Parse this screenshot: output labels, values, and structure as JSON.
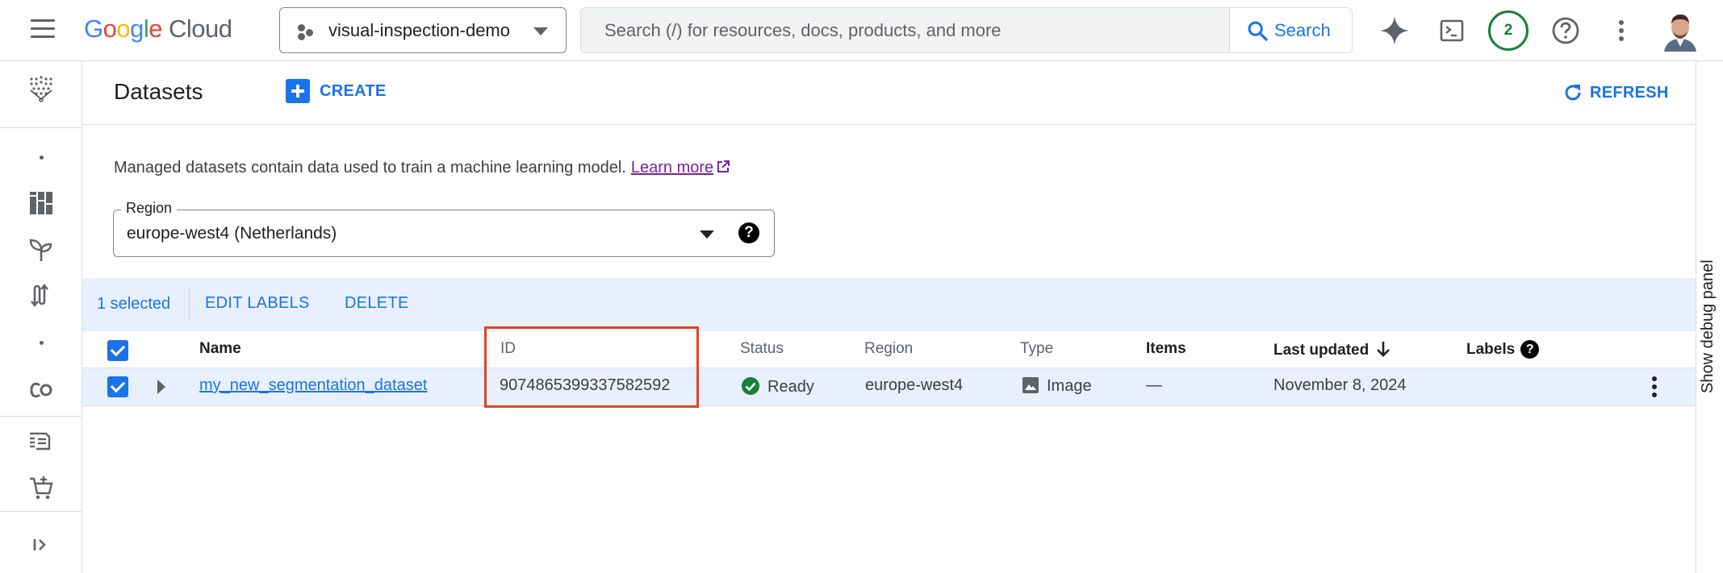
{
  "topbar": {
    "logo_google": [
      "G",
      "o",
      "o",
      "g",
      "l",
      "e"
    ],
    "logo_cloud": "Cloud",
    "project": "visual-inspection-demo",
    "search_placeholder": "Search (/) for resources, docs, products, and more",
    "search_button": "Search",
    "notifications_count": "2"
  },
  "page": {
    "title": "Datasets",
    "create_label": "CREATE",
    "refresh_label": "REFRESH",
    "description": "Managed datasets contain data used to train a machine learning model.",
    "learn_more": "Learn more"
  },
  "region": {
    "legend": "Region",
    "value": "europe-west4 (Netherlands)",
    "help": "?"
  },
  "selection": {
    "count": "1 selected",
    "edit_labels": "EDIT LABELS",
    "delete": "DELETE"
  },
  "table": {
    "headers": {
      "name": "Name",
      "id": "ID",
      "status": "Status",
      "region": "Region",
      "type": "Type",
      "items": "Items",
      "last_updated": "Last updated",
      "labels": "Labels"
    },
    "rows": [
      {
        "name": "my_new_segmentation_dataset",
        "id": "9074865399337582592",
        "status": "Ready",
        "region": "europe-west4",
        "type": "Image",
        "items": "—",
        "last_updated": "November 8, 2024",
        "labels": ""
      }
    ]
  },
  "debug_panel": "Show debug panel",
  "colors": {
    "accent": "#1a73e8",
    "status_ready": "#188038",
    "highlight": "#e8411f"
  }
}
